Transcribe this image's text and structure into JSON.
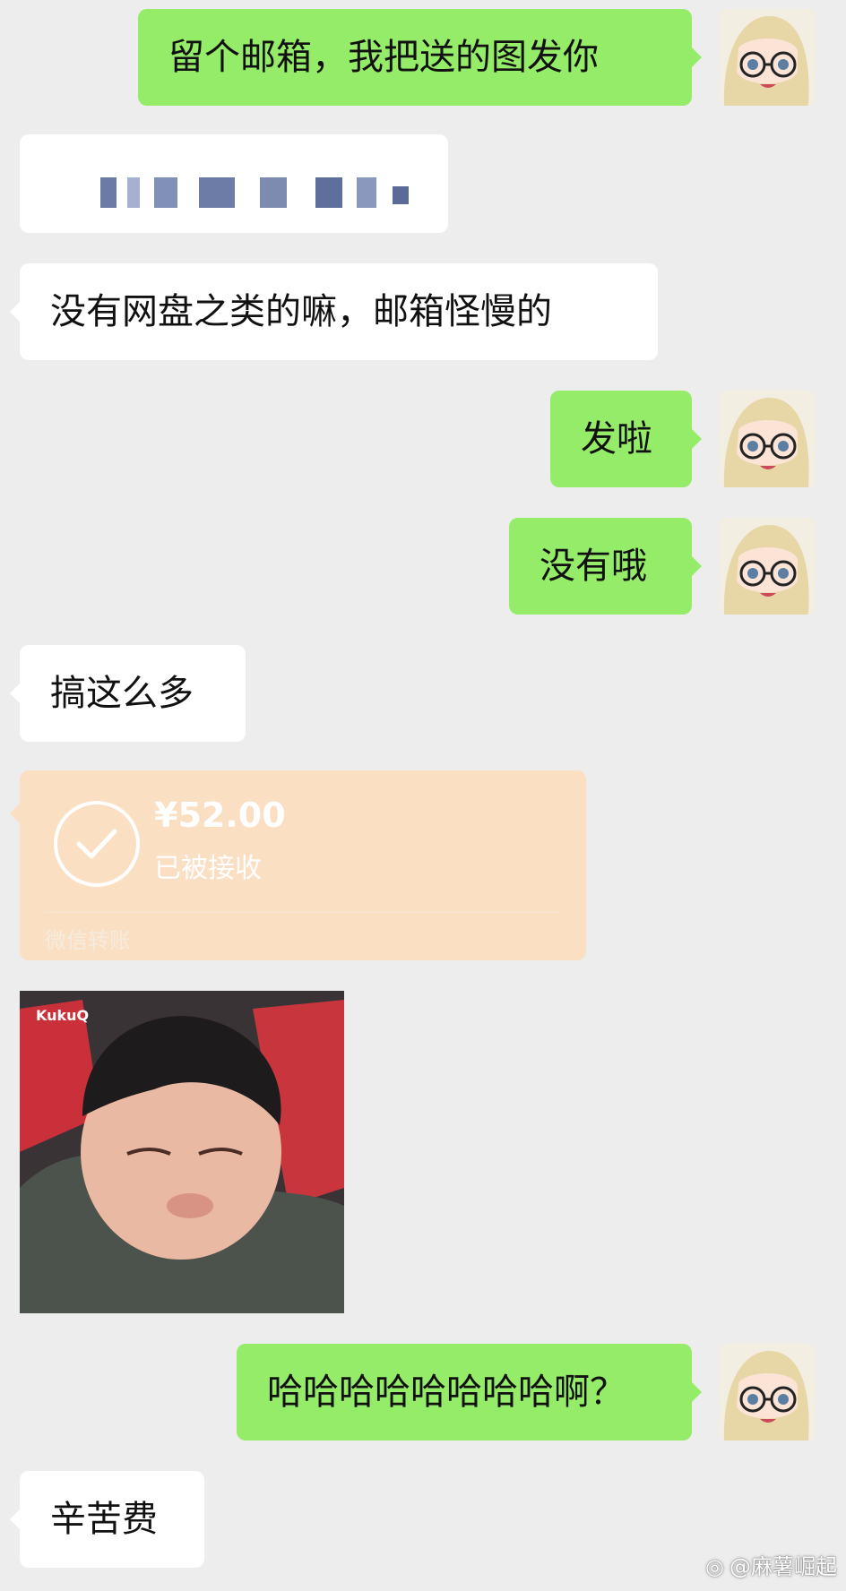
{
  "messages": {
    "m1": "留个邮箱，我把送的图发你",
    "m3": "没有网盘之类的嘛，邮箱怪慢的",
    "m4": "发啦",
    "m5": "没有哦",
    "m6": "搞这么多",
    "m9": "哈哈哈哈哈哈哈哈啊？",
    "m10": "辛苦费"
  },
  "transfer": {
    "amount": "¥52.00",
    "status": "已被接收",
    "source": "微信转账",
    "color": "#fbdfc2"
  },
  "sticker": {
    "tag": "KukuQ"
  },
  "watermark": {
    "text": "@麻薯崛起",
    "icon": "weibo-icon"
  },
  "colors": {
    "out_bubble": "#95ec69",
    "in_bubble": "#ffffff",
    "background": "#ededed"
  }
}
